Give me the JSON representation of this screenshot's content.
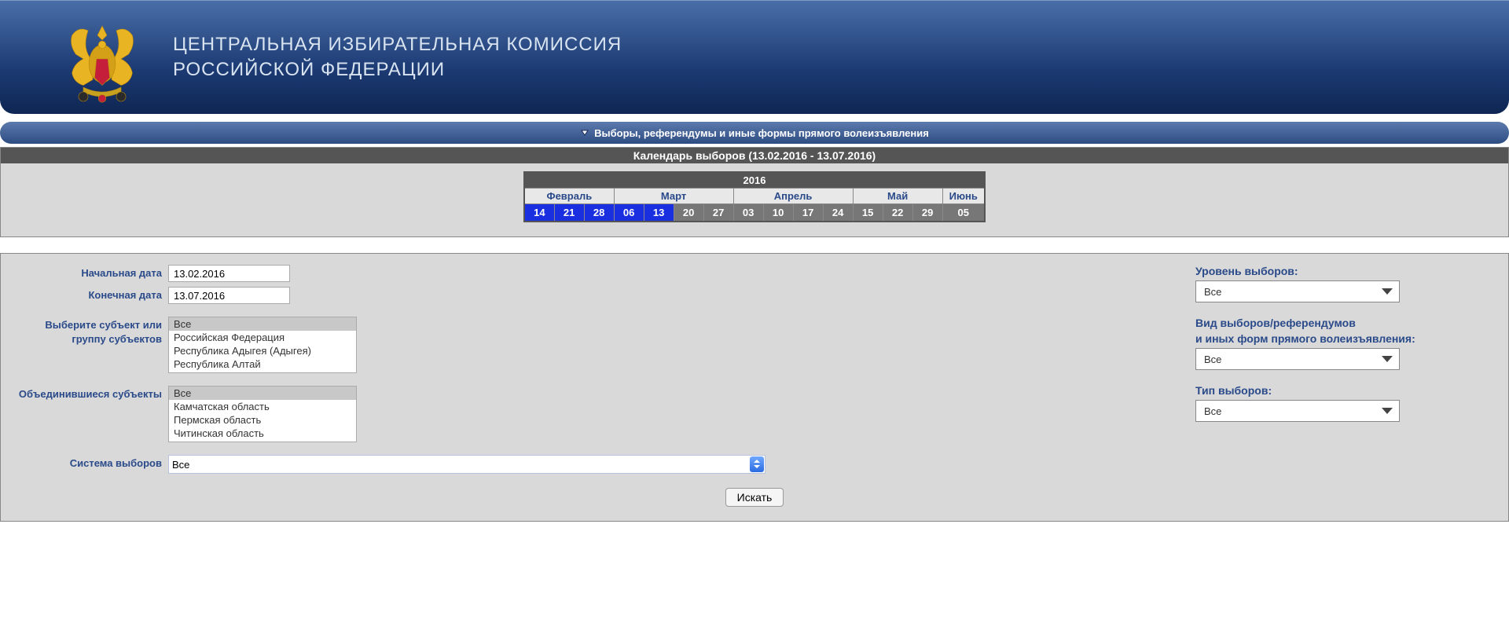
{
  "header": {
    "line1": "ЦЕНТРАЛЬНАЯ ИЗБИРАТЕЛЬНАЯ КОМИССИЯ",
    "line2": "РОССИЙСКОЙ ФЕДЕРАЦИИ"
  },
  "nav": {
    "title": "Выборы, референдумы и иные формы прямого волеизъявления"
  },
  "calendar": {
    "title": "Календарь выборов (13.02.2016 - 13.07.2016)",
    "year": "2016",
    "months": {
      "feb": "Февраль",
      "mar": "Март",
      "apr": "Апрель",
      "may": "Май",
      "jun": "Июнь"
    },
    "days": {
      "d0": "14",
      "d1": "21",
      "d2": "28",
      "d3": "06",
      "d4": "13",
      "d5": "20",
      "d6": "27",
      "d7": "03",
      "d8": "10",
      "d9": "17",
      "d10": "24",
      "d11": "15",
      "d12": "22",
      "d13": "29",
      "d14": "05"
    }
  },
  "form": {
    "start_date_label": "Начальная дата",
    "end_date_label": "Конечная дата",
    "start_date": "13.02.2016",
    "end_date": "13.07.2016",
    "subject_label": "Выберите субъект или группу субъектов",
    "subject_options": {
      "o0": "Все",
      "o1": "Российская Федерация",
      "o2": "Республика Адыгея (Адыгея)",
      "o3": "Республика Алтай"
    },
    "merged_label": "Объединившиеся субъекты",
    "merged_options": {
      "o0": "Все",
      "o1": "Камчатская область",
      "o2": "Пермская область",
      "o3": "Читинская область"
    },
    "system_label": "Система выборов",
    "system_value": "Все",
    "search_button": "Искать"
  },
  "right": {
    "level_label": "Уровень выборов:",
    "level_value": "Все",
    "kind_label_1": "Вид выборов/референдумов",
    "kind_label_2": "и иных форм прямого волеизъявления:",
    "kind_value": "Все",
    "type_label": "Тип выборов:",
    "type_value": "Все"
  }
}
